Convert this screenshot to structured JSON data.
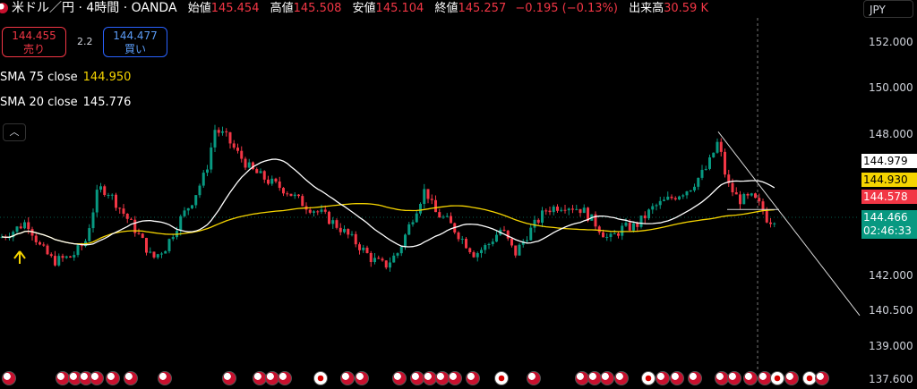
{
  "header": {
    "symbol": "米ドル／円 · 4時間 · OANDA",
    "open_label": "始値",
    "open": "145.454",
    "high_label": "高値",
    "high": "145.508",
    "low_label": "安値",
    "low": "145.104",
    "close_label": "終値",
    "close": "145.257",
    "change": "−0.195 (−0.13%)",
    "volume_label": "出来高",
    "volume": "30.59 K"
  },
  "trade": {
    "sell_price": "144.455",
    "sell_label": "売り",
    "spread": "2.2",
    "buy_price": "144.477",
    "buy_label": "買い"
  },
  "indicators": {
    "sma75_label": "SMA 75 close",
    "sma75_value": "144.950",
    "sma20_label": "SMA 20 close",
    "sma20_value": "145.776"
  },
  "collapse_icon": "chevron-up-icon",
  "currency": "JPY",
  "price_axis": {
    "ticks": [
      "152.000",
      "150.000",
      "148.000",
      "142.000",
      "140.500",
      "139.000",
      "137.600"
    ]
  },
  "price_tags": {
    "t1": "144.979",
    "t2": "144.930",
    "t3": "144.578",
    "t4": "144.466",
    "t4_time": "02:46:33"
  },
  "colors": {
    "up": "#089981",
    "down": "#f23645",
    "sma75": "#f5d400",
    "sma20": "#ffffff",
    "background": "#000000"
  },
  "chart_data": {
    "type": "candlestick",
    "series": [
      {
        "name": "SMA 75 close"
      },
      {
        "name": "SMA 20 close"
      }
    ]
  }
}
